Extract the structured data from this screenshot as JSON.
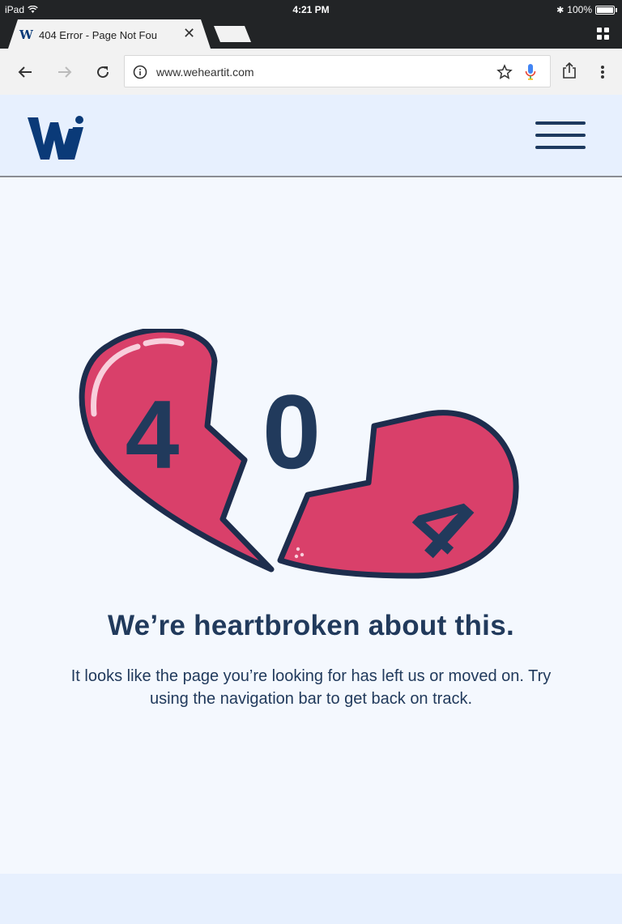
{
  "status_bar": {
    "device": "iPad",
    "time": "4:21 PM",
    "battery": "100%"
  },
  "browser": {
    "tab_title": "404 Error - Page Not Fou",
    "url": "www.weheartit.com",
    "icons": [
      "back-icon",
      "forward-icon",
      "reload-icon",
      "info-icon",
      "star-icon",
      "mic-icon",
      "share-icon",
      "menu-icon",
      "tab-switcher-icon"
    ]
  },
  "site": {
    "logo": "Wi",
    "brand_color": "#0a3a78",
    "nav_icon": "hamburger-icon"
  },
  "error": {
    "digit_1": "4",
    "digit_2": "0",
    "digit_3": "4",
    "heart_color": "#d9406a",
    "outline_color": "#1d2d4d",
    "headline": "We’re heartbroken about this.",
    "message": "It looks like the page you’re looking for has left us or moved on. Try using the navigation bar to get back on track."
  }
}
